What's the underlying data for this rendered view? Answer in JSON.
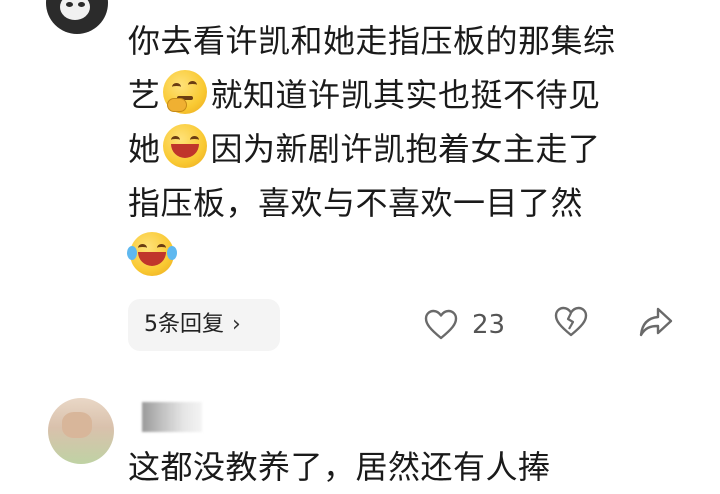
{
  "comment1": {
    "meta": "",
    "line1": "你去看许凯和她走指压板的那集综",
    "line2a": "艺",
    "line2b": "就知道许凯其实也挺不待见",
    "line3a": "她",
    "line3b": "因为新剧许凯抱着女主走了",
    "line4": "指压板，喜欢与不喜欢一目了然",
    "emojis": [
      "thinking-face-emoji",
      "grinning-squint-emoji",
      "laughing-tears-emoji"
    ],
    "reply_label": "5条回复",
    "like_count": "23"
  },
  "comment2": {
    "text": "这都没教养了，居然还有人捧"
  },
  "colors": {
    "text": "#1a1a1a",
    "meta": "#9a9a9a",
    "chip_bg": "#f4f4f4",
    "icon": "#6a6a6a"
  }
}
